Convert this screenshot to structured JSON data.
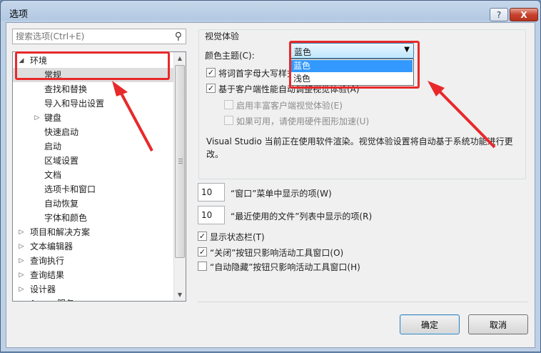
{
  "window": {
    "title": "选项",
    "help_label": "?",
    "close_label": "X"
  },
  "search": {
    "placeholder": "搜索选项(Ctrl+E)"
  },
  "tree": {
    "items": [
      {
        "label": "环境",
        "arrow": "◢",
        "level": 0
      },
      {
        "label": "常规",
        "arrow": "",
        "level": 1,
        "selected": true
      },
      {
        "label": "查找和替换",
        "arrow": "",
        "level": 1
      },
      {
        "label": "导入和导出设置",
        "arrow": "",
        "level": 1
      },
      {
        "label": "键盘",
        "arrow": "▷",
        "level": 1
      },
      {
        "label": "快速启动",
        "arrow": "",
        "level": 1
      },
      {
        "label": "启动",
        "arrow": "",
        "level": 1
      },
      {
        "label": "区域设置",
        "arrow": "",
        "level": 1
      },
      {
        "label": "文档",
        "arrow": "",
        "level": 1
      },
      {
        "label": "选项卡和窗口",
        "arrow": "",
        "level": 1
      },
      {
        "label": "自动恢复",
        "arrow": "",
        "level": 1
      },
      {
        "label": "字体和颜色",
        "arrow": "",
        "level": 1
      },
      {
        "label": "项目和解决方案",
        "arrow": "▷",
        "level": 0
      },
      {
        "label": "文本编辑器",
        "arrow": "▷",
        "level": 0
      },
      {
        "label": "查询执行",
        "arrow": "▷",
        "level": 0
      },
      {
        "label": "查询结果",
        "arrow": "▷",
        "level": 0
      },
      {
        "label": "设计器",
        "arrow": "▷",
        "level": 0
      },
      {
        "label": "Azure 服务",
        "arrow": "▷",
        "level": 0
      }
    ]
  },
  "visual": {
    "group_title": "视觉体验",
    "theme_label": "颜色主题(C):",
    "theme_value": "蓝色",
    "theme_options": [
      "蓝色",
      "浅色"
    ],
    "uppercase_label": "将词首字母大写样式",
    "uppercase_checked": true,
    "auto_adjust_label": "基于客户端性能自动调整视觉体验(A)",
    "auto_adjust_checked": true,
    "rich_label": "启用丰富客户端视觉体验(E)",
    "hw_label": "如果可用，请使用硬件图形加速(U)",
    "note": "Visual Studio 当前正在使用软件渲染。视觉体验设置将自动基于系统功能进行更改。"
  },
  "windows_menu": {
    "value": "10",
    "label": "“窗口”菜单中显示的项(W)"
  },
  "recent_files": {
    "value": "10",
    "label": "“最近使用的文件”列表中显示的项(R)"
  },
  "status_bar": {
    "label": "显示状态栏(T)",
    "checked": true
  },
  "close_button_option": {
    "label": "“关闭”按钮只影响活动工具窗口(O)",
    "checked": true
  },
  "autohide_option": {
    "label": "“自动隐藏”按钮只影响活动工具窗口(H)",
    "checked": false
  },
  "buttons": {
    "ok": "确定",
    "cancel": "取消"
  },
  "colors": {
    "callout": "#e8292a",
    "highlight": "#3399ff"
  }
}
